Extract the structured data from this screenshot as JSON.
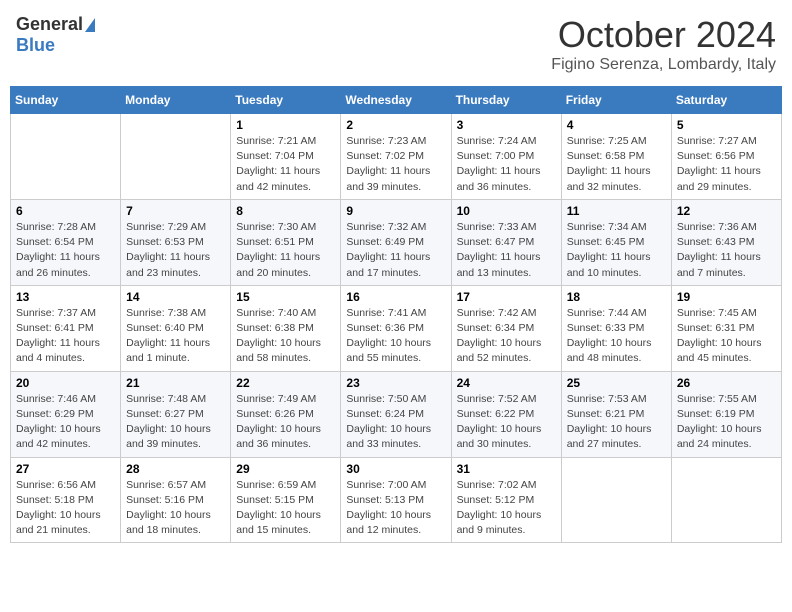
{
  "header": {
    "logo_general": "General",
    "logo_blue": "Blue",
    "month": "October 2024",
    "location": "Figino Serenza, Lombardy, Italy"
  },
  "days_of_week": [
    "Sunday",
    "Monday",
    "Tuesday",
    "Wednesday",
    "Thursday",
    "Friday",
    "Saturday"
  ],
  "weeks": [
    [
      {
        "day": "",
        "info": ""
      },
      {
        "day": "",
        "info": ""
      },
      {
        "day": "1",
        "info": "Sunrise: 7:21 AM\nSunset: 7:04 PM\nDaylight: 11 hours and 42 minutes."
      },
      {
        "day": "2",
        "info": "Sunrise: 7:23 AM\nSunset: 7:02 PM\nDaylight: 11 hours and 39 minutes."
      },
      {
        "day": "3",
        "info": "Sunrise: 7:24 AM\nSunset: 7:00 PM\nDaylight: 11 hours and 36 minutes."
      },
      {
        "day": "4",
        "info": "Sunrise: 7:25 AM\nSunset: 6:58 PM\nDaylight: 11 hours and 32 minutes."
      },
      {
        "day": "5",
        "info": "Sunrise: 7:27 AM\nSunset: 6:56 PM\nDaylight: 11 hours and 29 minutes."
      }
    ],
    [
      {
        "day": "6",
        "info": "Sunrise: 7:28 AM\nSunset: 6:54 PM\nDaylight: 11 hours and 26 minutes."
      },
      {
        "day": "7",
        "info": "Sunrise: 7:29 AM\nSunset: 6:53 PM\nDaylight: 11 hours and 23 minutes."
      },
      {
        "day": "8",
        "info": "Sunrise: 7:30 AM\nSunset: 6:51 PM\nDaylight: 11 hours and 20 minutes."
      },
      {
        "day": "9",
        "info": "Sunrise: 7:32 AM\nSunset: 6:49 PM\nDaylight: 11 hours and 17 minutes."
      },
      {
        "day": "10",
        "info": "Sunrise: 7:33 AM\nSunset: 6:47 PM\nDaylight: 11 hours and 13 minutes."
      },
      {
        "day": "11",
        "info": "Sunrise: 7:34 AM\nSunset: 6:45 PM\nDaylight: 11 hours and 10 minutes."
      },
      {
        "day": "12",
        "info": "Sunrise: 7:36 AM\nSunset: 6:43 PM\nDaylight: 11 hours and 7 minutes."
      }
    ],
    [
      {
        "day": "13",
        "info": "Sunrise: 7:37 AM\nSunset: 6:41 PM\nDaylight: 11 hours and 4 minutes."
      },
      {
        "day": "14",
        "info": "Sunrise: 7:38 AM\nSunset: 6:40 PM\nDaylight: 11 hours and 1 minute."
      },
      {
        "day": "15",
        "info": "Sunrise: 7:40 AM\nSunset: 6:38 PM\nDaylight: 10 hours and 58 minutes."
      },
      {
        "day": "16",
        "info": "Sunrise: 7:41 AM\nSunset: 6:36 PM\nDaylight: 10 hours and 55 minutes."
      },
      {
        "day": "17",
        "info": "Sunrise: 7:42 AM\nSunset: 6:34 PM\nDaylight: 10 hours and 52 minutes."
      },
      {
        "day": "18",
        "info": "Sunrise: 7:44 AM\nSunset: 6:33 PM\nDaylight: 10 hours and 48 minutes."
      },
      {
        "day": "19",
        "info": "Sunrise: 7:45 AM\nSunset: 6:31 PM\nDaylight: 10 hours and 45 minutes."
      }
    ],
    [
      {
        "day": "20",
        "info": "Sunrise: 7:46 AM\nSunset: 6:29 PM\nDaylight: 10 hours and 42 minutes."
      },
      {
        "day": "21",
        "info": "Sunrise: 7:48 AM\nSunset: 6:27 PM\nDaylight: 10 hours and 39 minutes."
      },
      {
        "day": "22",
        "info": "Sunrise: 7:49 AM\nSunset: 6:26 PM\nDaylight: 10 hours and 36 minutes."
      },
      {
        "day": "23",
        "info": "Sunrise: 7:50 AM\nSunset: 6:24 PM\nDaylight: 10 hours and 33 minutes."
      },
      {
        "day": "24",
        "info": "Sunrise: 7:52 AM\nSunset: 6:22 PM\nDaylight: 10 hours and 30 minutes."
      },
      {
        "day": "25",
        "info": "Sunrise: 7:53 AM\nSunset: 6:21 PM\nDaylight: 10 hours and 27 minutes."
      },
      {
        "day": "26",
        "info": "Sunrise: 7:55 AM\nSunset: 6:19 PM\nDaylight: 10 hours and 24 minutes."
      }
    ],
    [
      {
        "day": "27",
        "info": "Sunrise: 6:56 AM\nSunset: 5:18 PM\nDaylight: 10 hours and 21 minutes."
      },
      {
        "day": "28",
        "info": "Sunrise: 6:57 AM\nSunset: 5:16 PM\nDaylight: 10 hours and 18 minutes."
      },
      {
        "day": "29",
        "info": "Sunrise: 6:59 AM\nSunset: 5:15 PM\nDaylight: 10 hours and 15 minutes."
      },
      {
        "day": "30",
        "info": "Sunrise: 7:00 AM\nSunset: 5:13 PM\nDaylight: 10 hours and 12 minutes."
      },
      {
        "day": "31",
        "info": "Sunrise: 7:02 AM\nSunset: 5:12 PM\nDaylight: 10 hours and 9 minutes."
      },
      {
        "day": "",
        "info": ""
      },
      {
        "day": "",
        "info": ""
      }
    ]
  ]
}
